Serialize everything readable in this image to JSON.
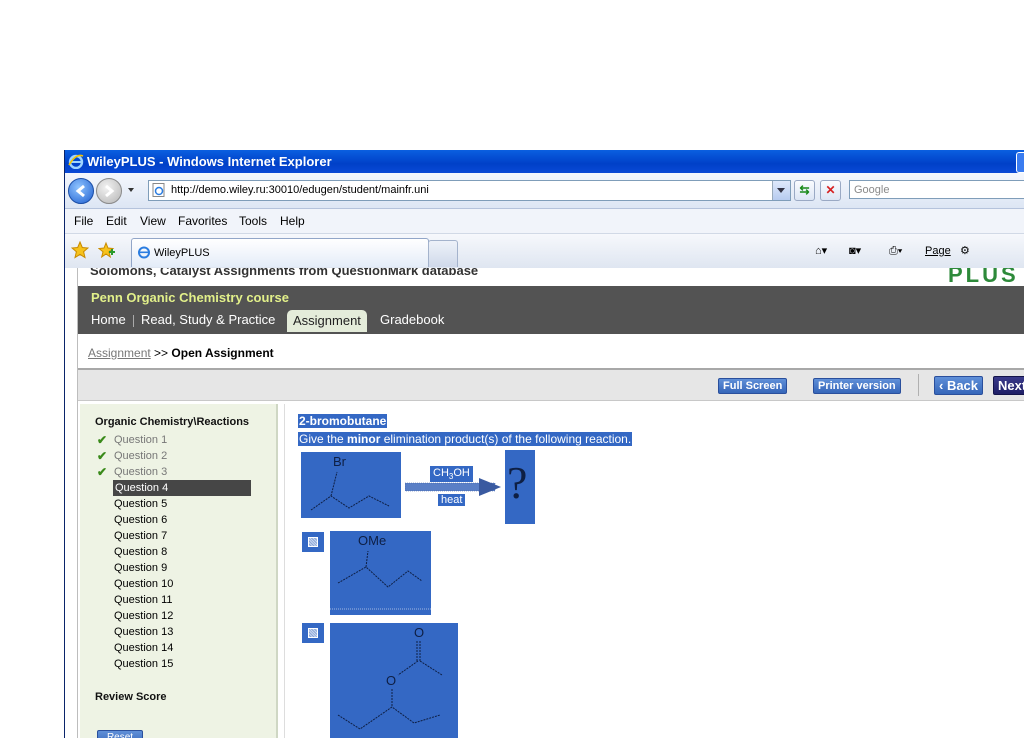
{
  "window": {
    "title": "WileyPLUS - Windows Internet Explorer"
  },
  "address_bar": {
    "url": "http://demo.wiley.ru:30010/edugen/student/mainfr.uni",
    "search_placeholder": "Google"
  },
  "menu": [
    "File",
    "Edit",
    "View",
    "Favorites",
    "Tools",
    "Help"
  ],
  "browser_tab": {
    "label": "WileyPLUS"
  },
  "command_bar": {
    "page_label": "Page"
  },
  "page": {
    "header_cut": "Solomons, Catalyst Assignments from QuestionMark database",
    "logo": "PLUS",
    "course_name": "Penn Organic Chemistry course",
    "nav_tabs": [
      "Home",
      "Read, Study & Practice",
      "Assignment",
      "Gradebook"
    ],
    "breadcrumb": {
      "link": "Assignment",
      "sep": ">>",
      "current": "Open Assignment"
    },
    "toolbar": {
      "full_screen": "Full Screen",
      "printer": "Printer version",
      "back": "‹ Back",
      "next": "Next"
    }
  },
  "sidebar": {
    "title": "Organic Chemistry\\Reactions",
    "questions": [
      {
        "label": "Question 1",
        "done": true
      },
      {
        "label": "Question 2",
        "done": true
      },
      {
        "label": "Question 3",
        "done": true
      },
      {
        "label": "Question 4",
        "current": true
      },
      {
        "label": "Question 5"
      },
      {
        "label": "Question 6"
      },
      {
        "label": "Question 7"
      },
      {
        "label": "Question 8"
      },
      {
        "label": "Question 9"
      },
      {
        "label": "Question 10"
      },
      {
        "label": "Question 11"
      },
      {
        "label": "Question 12"
      },
      {
        "label": "Question 13"
      },
      {
        "label": "Question 14"
      },
      {
        "label": "Question 15"
      }
    ],
    "review_score": "Review Score",
    "reset": "Reset"
  },
  "question": {
    "title": "2-bromobutane",
    "text_before": "Give the ",
    "text_bold": "minor",
    "text_after": " elimination product(s) of the following reaction.",
    "reactant_label": "Br",
    "reagent_base": "CH",
    "reagent_sub": "3",
    "reagent_rest": "OH",
    "condition": "heat",
    "unknown": "?",
    "option1_label": "OMe",
    "option2_label_top": "O",
    "option2_label_mid": "O"
  },
  "colors": {
    "highlight": "#3468c4",
    "title_bar": "#0a5fe0",
    "nav_dark": "#535353",
    "course_name": "#e2f08a",
    "sidebar_bg": "#eef3e4"
  }
}
